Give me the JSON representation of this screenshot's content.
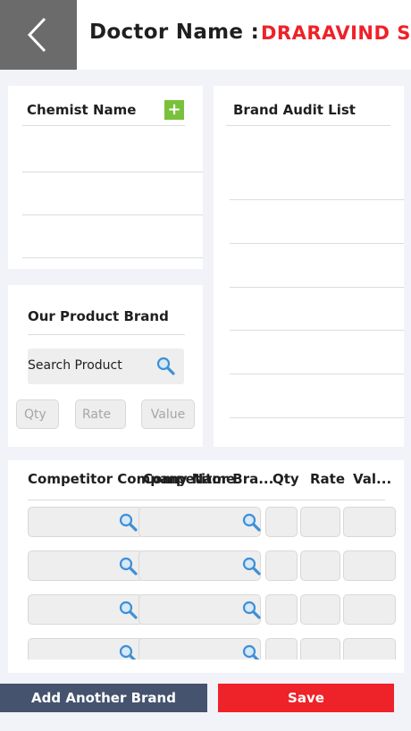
{
  "header": {
    "back_icon": "chevron-left-icon",
    "doctor_label": "Doctor Name :",
    "doctor_name": "DRARAVIND SA"
  },
  "chemist": {
    "title": "Chemist Name",
    "add_icon": "plus-icon",
    "add_symbol": "+"
  },
  "brand_audit": {
    "title": "Brand Audit List"
  },
  "our_product": {
    "title": "Our Product Brand",
    "search_placeholder": "Search Product",
    "qty_placeholder": "Qty",
    "rate_placeholder": "Rate",
    "value_placeholder": "Value"
  },
  "competitor": {
    "col_company": "Competitor Company Name",
    "col_brand": "Competitor Bra...",
    "col_qty": "Qty",
    "col_rate": "Rate",
    "col_value": "Val..."
  },
  "actions": {
    "add_brand": "Add Another Brand",
    "save": "Save"
  },
  "colors": {
    "accent_red": "#ee2229",
    "nav_blue": "#45536f",
    "plus_green": "#7ac13b",
    "search_icon_blue": "#3e8fd6"
  }
}
